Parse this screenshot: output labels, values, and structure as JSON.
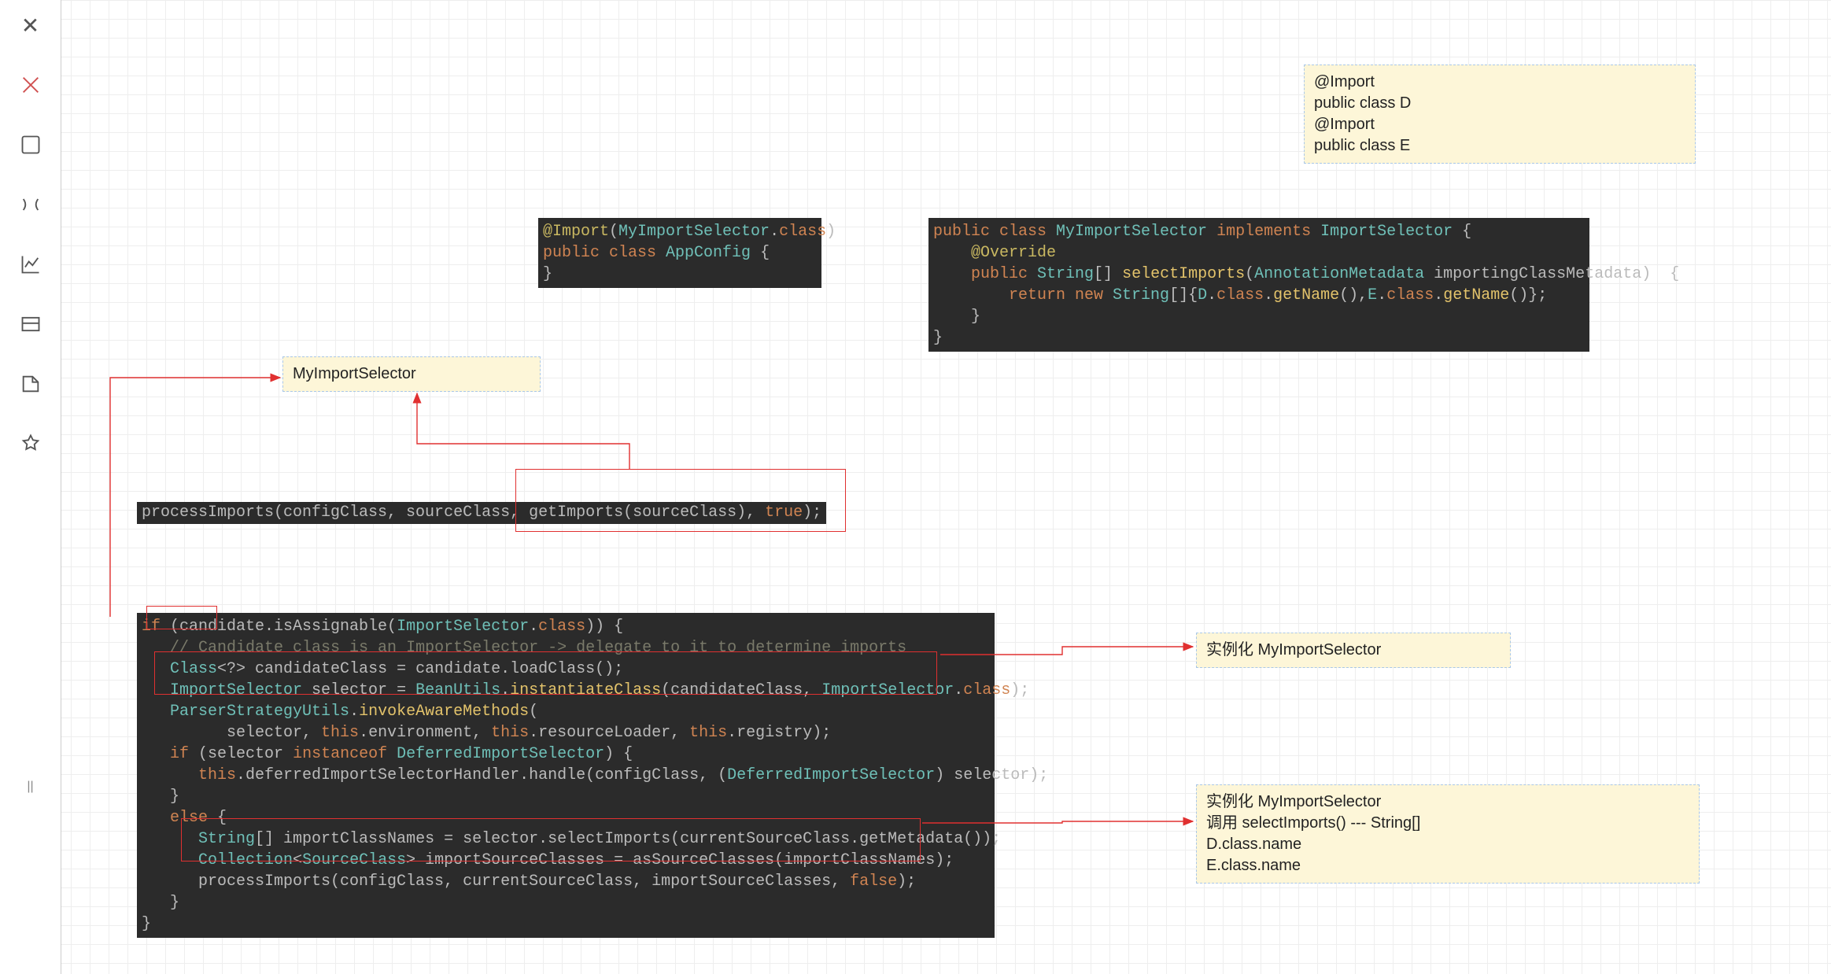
{
  "sidebar": {
    "close": "✕"
  },
  "notes": {
    "topright": "@Import\npublic class D\n@Import\npublic class E",
    "myimportselector": "MyImportSelector",
    "instantiate": "实例化 MyImportSelector",
    "detail": "实例化 MyImportSelector\n调用 selectImports() --- String[]\nD.class.name\nE.class.name"
  },
  "code": {
    "appconfig": {
      "l1a": "@Import",
      "l1b": "(",
      "l1c": "MyImportSelector",
      "l1d": ".",
      "l1e": "class",
      "l1f": ")",
      "l2a": "public class ",
      "l2b": "AppConfig ",
      "l2c": "{",
      "l3": "}"
    },
    "selector": {
      "l1a": "public class ",
      "l1b": "MyImportSelector ",
      "l1c": "implements ",
      "l1d": "ImportSelector ",
      "l1e": "{",
      "l2a": "    ",
      "l2b": "@Override",
      "l3a": "    ",
      "l3b": "public ",
      "l3c": "String",
      "l3d": "[] ",
      "l3e": "selectImports",
      "l3f": "(",
      "l3g": "AnnotationMetadata ",
      "l3h": "importingClassMetadata)  {",
      "l4a": "        ",
      "l4b": "return new ",
      "l4c": "String",
      "l4d": "[]{",
      "l4e": "D",
      "l4f": ".",
      "l4g": "class",
      "l4h": ".",
      "l4i": "getName",
      "l4j": "(),",
      "l4k": "E",
      "l4l": ".",
      "l4m": "class",
      "l4n": ".",
      "l4o": "getName",
      "l4p": "()};",
      "l5": "    }",
      "l6": "}"
    },
    "processline": {
      "a": "processImports(configClass, sourceClass, getImports(sourceClass), ",
      "b": "true",
      "c": ");"
    },
    "block": {
      "l1a": "if ",
      "l1b": "(candidate.isAssignable(",
      "l1c": "ImportSelector",
      "l1d": ".",
      "l1e": "class",
      "l1f": ")) {",
      "l2a": "   ",
      "l2b": "// Candidate class is an ImportSelector -> delegate to it to determine imports",
      "l3a": "   ",
      "l3b": "Class",
      "l3c": "<?> candidateClass = candidate.loadClass();",
      "l4a": "   ",
      "l4b": "ImportSelector ",
      "l4c": "selector = ",
      "l4d": "BeanUtils",
      "l4e": ".",
      "l4f": "instantiateClass",
      "l4g": "(candidateClass, ",
      "l4h": "ImportSelector",
      "l4i": ".",
      "l4j": "class",
      "l4k": ");",
      "l5a": "   ",
      "l5b": "ParserStrategyUtils",
      "l5c": ".",
      "l5d": "invokeAwareMethods",
      "l5e": "(",
      "l6a": "         selector, ",
      "l6b": "this",
      "l6c": ".environment, ",
      "l6d": "this",
      "l6e": ".resourceLoader, ",
      "l6f": "this",
      "l6g": ".registry);",
      "l7a": "   ",
      "l7b": "if ",
      "l7c": "(selector ",
      "l7d": "instanceof ",
      "l7e": "DeferredImportSelector",
      "l7f": ") {",
      "l8a": "      ",
      "l8b": "this",
      "l8c": ".deferredImportSelectorHandler.handle(configClass, (",
      "l8d": "DeferredImportSelector",
      "l8e": ") selector);",
      "l9": "   }",
      "l10a": "   ",
      "l10b": "else ",
      "l10c": "{",
      "l11a": "      ",
      "l11b": "String",
      "l11c": "[] importClassNames = selector.selectImports(currentSourceClass.getMetadata());",
      "l12a": "      ",
      "l12b": "Collection",
      "l12c": "<",
      "l12d": "SourceClass",
      "l12e": "> importSourceClasses = asSourceClasses(importClassNames);",
      "l13a": "      processImports(configClass, currentSourceClass, importSourceClasses, ",
      "l13b": "false",
      "l13c": ");",
      "l14": "   }",
      "l15": "}"
    }
  }
}
